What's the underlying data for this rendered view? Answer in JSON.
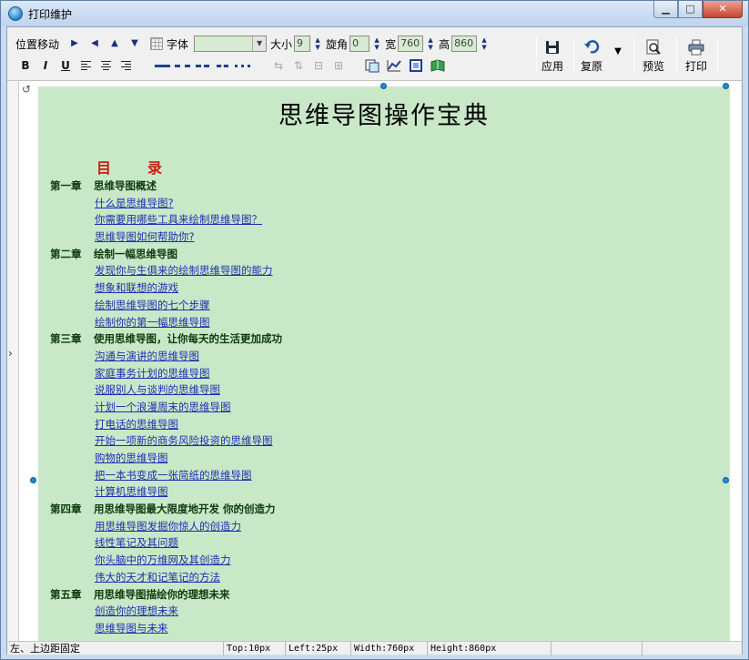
{
  "window": {
    "title": "打印维护",
    "minimize_label": "▁",
    "maximize_label": "□",
    "close_label": "✕"
  },
  "toolbar": {
    "position_move_label": "位置移动",
    "arrow_right": "▶",
    "arrow_left": "◀",
    "arrow_up": "▲",
    "arrow_down": "▼",
    "font_label": "字体",
    "font_value": "",
    "size_label": "大小",
    "size_value": "9",
    "rotation_label": "旋角",
    "rotation_value": "0",
    "width_label": "宽",
    "width_value": "760",
    "height_label": "高",
    "height_value": "860",
    "bold_label": "B",
    "italic_label": "I",
    "underline_label": "U",
    "apply_label": "应用",
    "restore_label": "复原",
    "preview_label": "预览",
    "print_label": "打印"
  },
  "document": {
    "title": "思维导图操作宝典",
    "toc_heading": "目录",
    "lines": [
      {
        "chapter": "第一章",
        "text": "思维导图概述"
      },
      {
        "sub": "什么是思维导图?"
      },
      {
        "sub": "你需要用哪些工具来绘制思维导图？"
      },
      {
        "sub": "思维导图如何帮助你?"
      },
      {
        "chapter": "第二章",
        "text": "绘制一幅思维导图"
      },
      {
        "sub": "发现你与生俱来的绘制思维导图的能力"
      },
      {
        "sub": "想象和联想的游戏"
      },
      {
        "sub": "绘制思维导图的七个步骤"
      },
      {
        "sub": "绘制你的第一幅思维导图"
      },
      {
        "chapter": "第三章",
        "text": "使用思维导图，让你每天的生活更加成功"
      },
      {
        "sub": "沟通与演讲的思维导图"
      },
      {
        "sub": "家庭事务计划的思维导图"
      },
      {
        "sub": "说服别人与谈判的思维导图"
      },
      {
        "sub": "计划一个浪漫周末的思维导图"
      },
      {
        "sub": "打电话的思维导图"
      },
      {
        "sub": "开始一项新的商务风险投资的思维导图"
      },
      {
        "sub": "购物的思维导图"
      },
      {
        "sub": "把一本书变成一张简纸的思维导图"
      },
      {
        "sub": "计算机思维导图"
      },
      {
        "chapter": "第四章",
        "text": "用思维导图最大限度地开发 你的创造力"
      },
      {
        "sub": "用思维导图发掘你惊人的创造力"
      },
      {
        "sub": "线性笔记及其问题"
      },
      {
        "sub": "你头脑中的万维网及其创造力"
      },
      {
        "sub": "伟大的天才和记笔记的方法"
      },
      {
        "chapter": "第五章",
        "text": "用思维导图描绘你的理想未来"
      },
      {
        "sub": "创造你的理想未来"
      },
      {
        "sub": "思维导图与未来"
      }
    ]
  },
  "status": {
    "mode": "左、上边距固定",
    "top": "Top:10px",
    "left": "Left:25px",
    "width": "Width:760px",
    "height": "Height:860px"
  },
  "colors": {
    "doc_background": "#c9e8c8",
    "toc_heading": "#d11a0f",
    "link": "#1d2fb0",
    "chapter": "#0d3b0d",
    "handle": "#1a8ed8"
  }
}
